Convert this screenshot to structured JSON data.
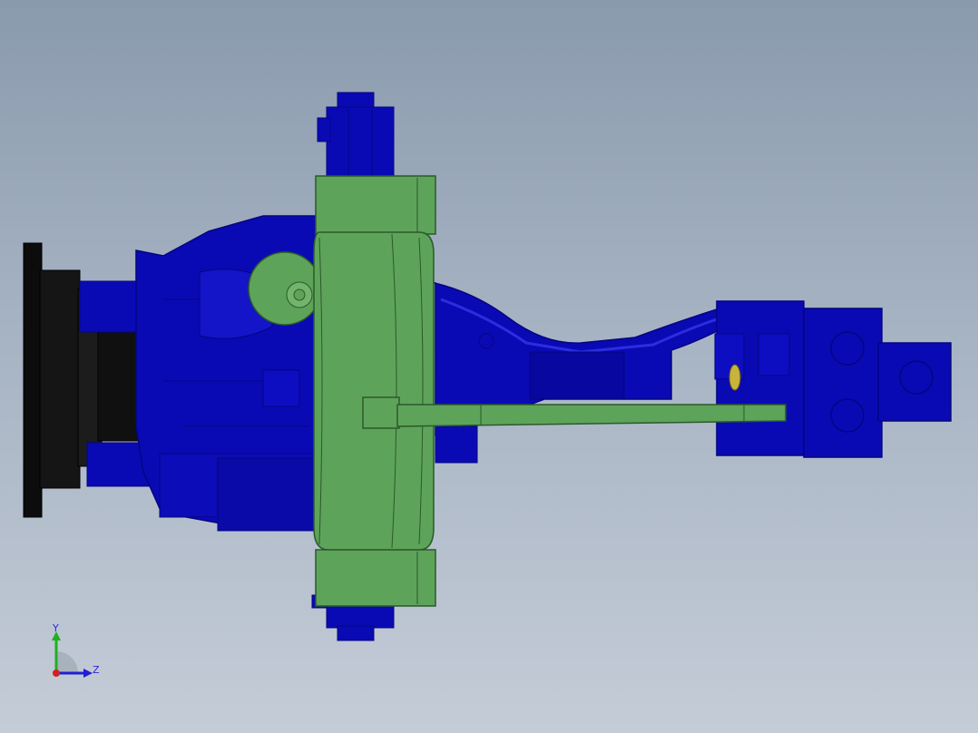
{
  "viewport": {
    "background_top": "#8a9aad",
    "background_bottom": "#c4ccd7"
  },
  "model": {
    "colors": {
      "body": "#0a0ab4",
      "body_dark": "#050580",
      "body_light": "#2d2de0",
      "base": "#0c0c0c",
      "green": "#5ea35a",
      "green_dark": "#2b5a2a",
      "green_light": "#72b46c",
      "yellow": "#c8b43a"
    }
  },
  "triad": {
    "y_label": "Y",
    "z_label": "Z",
    "y_color": "#20b020",
    "z_color": "#2020d0",
    "origin_color": "#d02020"
  }
}
